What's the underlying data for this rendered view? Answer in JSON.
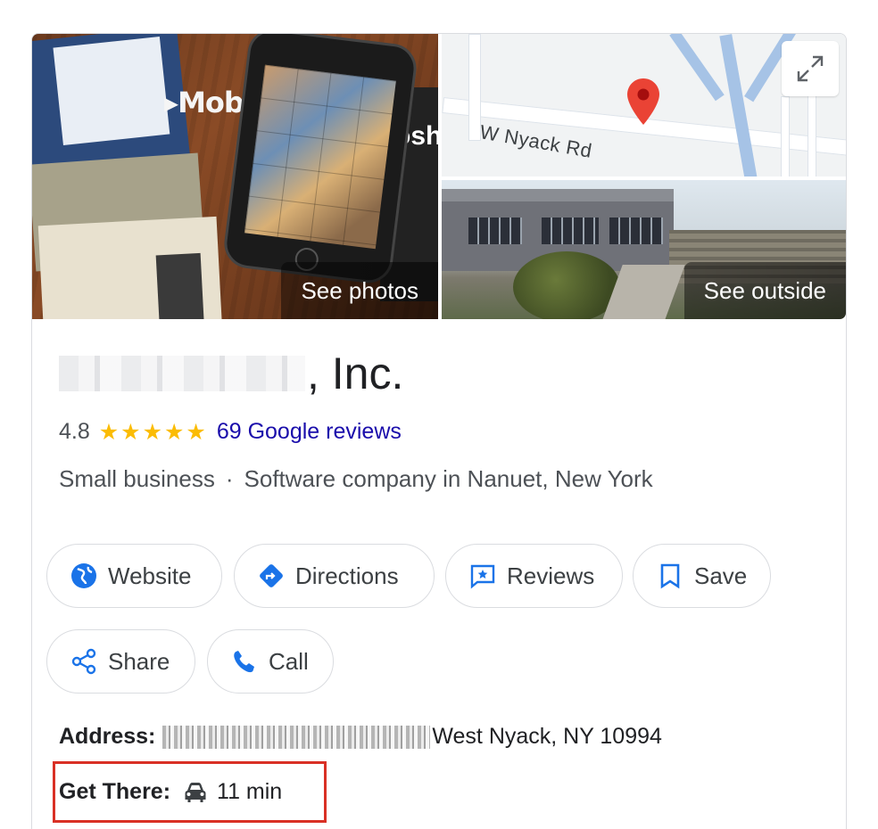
{
  "media": {
    "photos_label": "See photos",
    "outside_label": "See outside",
    "photo_text_mobile": "Mobile",
    "map_road_label": "W Nyack Rd"
  },
  "business": {
    "name_suffix": ", Inc.",
    "rating": "4.8",
    "stars": "★★★★★",
    "reviews_link": "69 Google reviews",
    "category_primary": "Small business",
    "separator": "·",
    "category_secondary": "Software company in Nanuet, New York"
  },
  "actions": {
    "website": "Website",
    "directions": "Directions",
    "reviews": "Reviews",
    "save": "Save",
    "share": "Share",
    "call": "Call"
  },
  "details": {
    "address_label": "Address:",
    "address_value": "West Nyack, NY 10994",
    "get_there_label": "Get There:",
    "get_there_value": "11 min"
  },
  "colors": {
    "accent_blue": "#1a73e8",
    "link_blue": "#1a0dab",
    "star_yellow": "#fbbc04",
    "highlight_red": "#d93025"
  }
}
